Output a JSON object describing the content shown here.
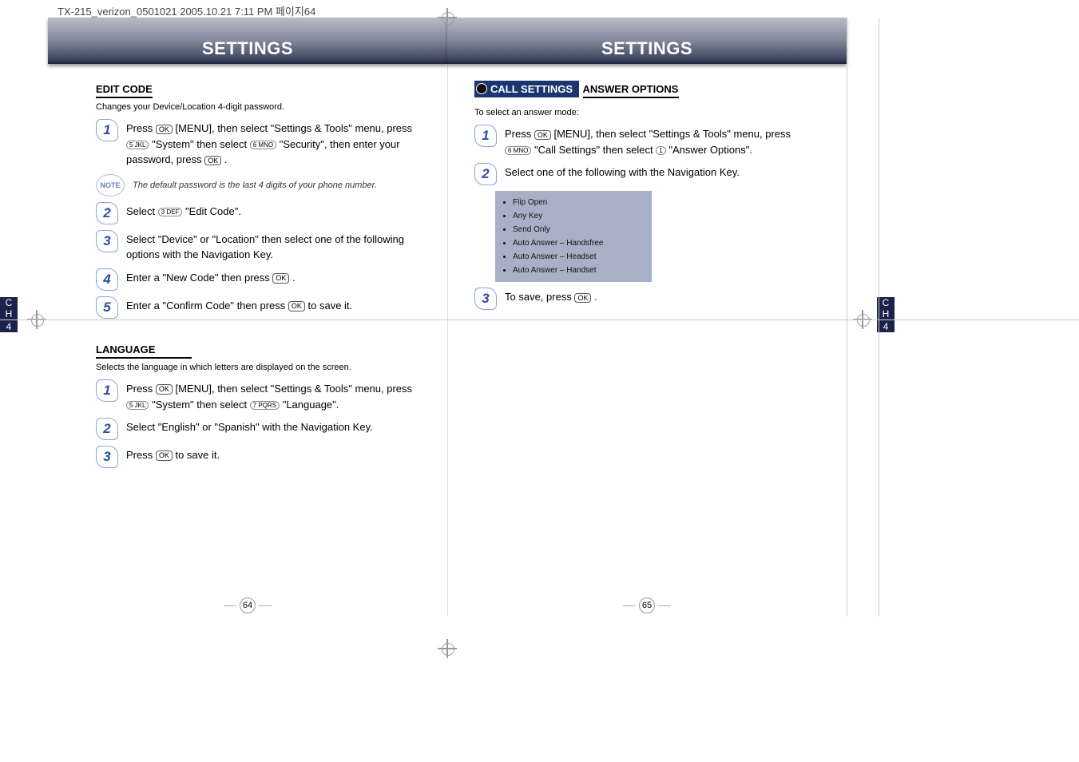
{
  "header": "TX-215_verizon_0501021  2005.10.21  7:11 PM  페이지64",
  "banner_left": "SETTINGS",
  "banner_right": "SETTINGS",
  "ch_label_top": "C\nH",
  "ch_label_num": "4",
  "left_page": {
    "page_number": "64",
    "edit_code": {
      "title": "EDIT CODE",
      "subtitle": "Changes your Device/Location 4-digit password.",
      "step1_a": "Press ",
      "step1_b": " [MENU], then select \"Settings & Tools\" menu, press ",
      "step1_c": " \"System\" then select ",
      "step1_d": " \"Security\", then enter your password, press ",
      "step1_e": " .",
      "note": "The default password is the last 4 digits of your phone number.",
      "step2_a": "Select ",
      "step2_b": " \"Edit Code\".",
      "step3": "Select \"Device\" or \"Location\" then select one of the following options with the Navigation Key.",
      "step4_a": "Enter a \"New Code\" then press ",
      "step4_b": " .",
      "step5_a": "Enter a \"Confirm Code\" then press ",
      "step5_b": " to save it."
    },
    "language": {
      "title": "LANGUAGE",
      "subtitle": "Selects the language in which letters are displayed on the screen.",
      "step1_a": "Press ",
      "step1_b": " [MENU], then select \"Settings & Tools\" menu, press ",
      "step1_c": " \"System\" then select ",
      "step1_d": " \"Language\".",
      "step2": "Select \"English\" or \"Spanish\" with the Navigation Key.",
      "step3_a": "Press ",
      "step3_b": " to save it."
    }
  },
  "right_page": {
    "page_number": "65",
    "call_settings_tab": "CALL SETTINGS",
    "answer_options": {
      "title": "ANSWER OPTIONS",
      "subtitle": "To select an answer mode:",
      "step1_a": "Press ",
      "step1_b": " [MENU], then select \"Settings & Tools\" menu, press ",
      "step1_c": " \"Call Settings\" then select ",
      "step1_d": " \"Answer Options\".",
      "step2": "Select one of the following with the Navigation Key.",
      "options": [
        "Flip Open",
        "Any Key",
        "Send Only",
        "Auto Answer – Handsfree",
        "Auto Answer – Headset",
        "Auto Answer – Handset"
      ],
      "step3_a": "To save, press ",
      "step3_b": " ."
    }
  },
  "keys": {
    "ok": "OK",
    "k5": "5 JKL",
    "k6": "6 MNO",
    "k3": "3 DEF",
    "k7": "7 PQRS",
    "k1": "1"
  }
}
